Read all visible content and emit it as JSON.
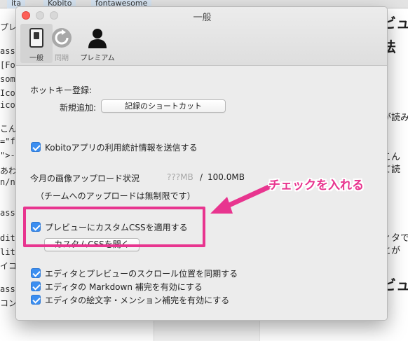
{
  "background": {
    "tabs": [
      "ita",
      "Kobito",
      "fontawesome"
    ],
    "editor_lines": [
      "プレ",
      "ass=",
      "[Fon",
      "some",
      "Icon",
      "icon",
      "こん",
      "=\"fa",
      "\">-",
      "あわ",
      "n/no",
      "ass=",
      "dita",
      "lita",
      "イコ",
      "ass",
      "コン"
    ],
    "preview_lines": [
      "ビュ",
      "法",
      "が読み",
      "こん",
      "て読",
      "ィタで",
      "とが",
      "ビュ"
    ]
  },
  "window": {
    "title": "一般"
  },
  "toolbar": {
    "items": [
      {
        "label": "一般",
        "icon": "switch-icon",
        "selected": true
      },
      {
        "label": "同期",
        "icon": "sync-icon",
        "disabled": true
      },
      {
        "label": "プレミアム",
        "icon": "person-icon"
      }
    ]
  },
  "hotkey": {
    "section_label": "ホットキー登録:",
    "new_label": "新規追加:",
    "record_button": "記録のショートカット"
  },
  "stats_checkbox": {
    "label": "Kobitoアプリの利用統計情報を送信する",
    "checked": true
  },
  "upload": {
    "label": "今月の画像アップロード状況",
    "used": "???MB",
    "separator": "/",
    "limit": "100.0MB",
    "note": "（チームへのアップロードは無制限です）"
  },
  "custom_css": {
    "checkbox_label": "プレビューにカスタムCSSを適用する",
    "checked": true,
    "open_button": "カスタムCSSを開く"
  },
  "options": [
    {
      "label": "エディタとプレビューのスクロール位置を同期する",
      "checked": true
    },
    {
      "label": "エディタの Markdown 補完を有効にする",
      "checked": true
    },
    {
      "label": "エディタの絵文字・メンション補完を有効にする",
      "checked": true
    }
  ],
  "annotation": {
    "text": "チェックを入れる",
    "color": "#e8358f"
  }
}
